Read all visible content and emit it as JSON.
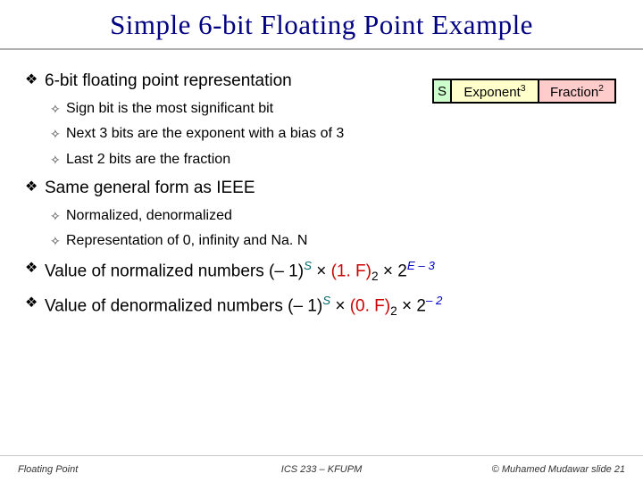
{
  "title": "Simple 6-bit Floating Point Example",
  "fields": {
    "s": "S",
    "exp_label": "Exponent",
    "exp_bits": "3",
    "frac_label": "Fraction",
    "frac_bits": "2"
  },
  "b1": "6-bit floating point representation",
  "b1s1": "Sign bit is the most significant bit",
  "b1s2": "Next 3 bits are the exponent with a bias of 3",
  "b1s3": "Last 2 bits are the fraction",
  "b2": "Same general form as IEEE",
  "b2s1": "Normalized, denormalized",
  "b2s2": "Representation of 0, infinity and Na. N",
  "b3": {
    "lead": "Value of normalized numbers (– 1)",
    "supS": "S",
    "times1": " × ",
    "mant": "(1. F)",
    "sub2a": "2",
    "times2": " × 2",
    "expE": "E – 3"
  },
  "b4": {
    "lead": "Value of denormalized numbers (– 1)",
    "supS": "S",
    "times1": " × ",
    "mant": "(0. F)",
    "sub2a": "2",
    "times2": " × 2",
    "expC": "– 2"
  },
  "footer": {
    "left": "Floating Point",
    "mid": "ICS 233 – KFUPM",
    "right": "© Muhamed Mudawar  slide 21"
  }
}
